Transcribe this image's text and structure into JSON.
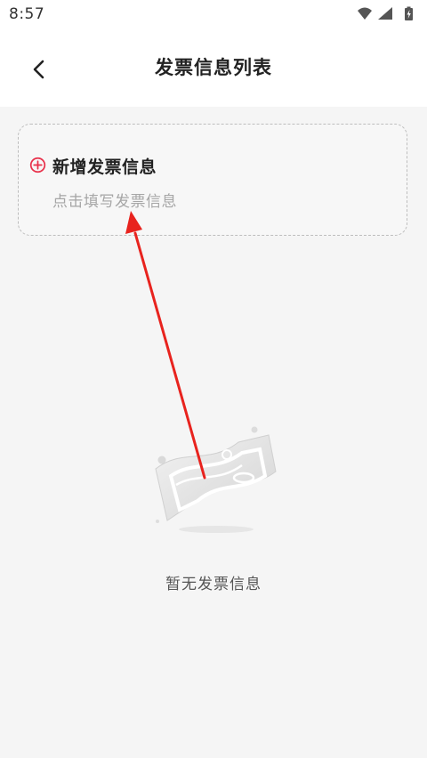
{
  "status_bar": {
    "time": "8:57",
    "icons": [
      "wifi-icon",
      "cellular-signal-icon",
      "battery-charging-icon"
    ]
  },
  "header": {
    "back_icon": "chevron-left-icon",
    "title": "发票信息列表"
  },
  "add_card": {
    "icon": "plus-circle-icon",
    "title": "新增发票信息",
    "subtitle": "点击填写发票信息"
  },
  "empty_state": {
    "illustration": "empty-ticket-illustration",
    "message": "暂无发票信息"
  },
  "colors": {
    "accent": "#e8304a",
    "annotation_arrow": "#e8231e",
    "background": "#f5f5f5",
    "title_text": "#222222",
    "subtitle_text": "#a6a6a6",
    "empty_text": "#555555"
  }
}
